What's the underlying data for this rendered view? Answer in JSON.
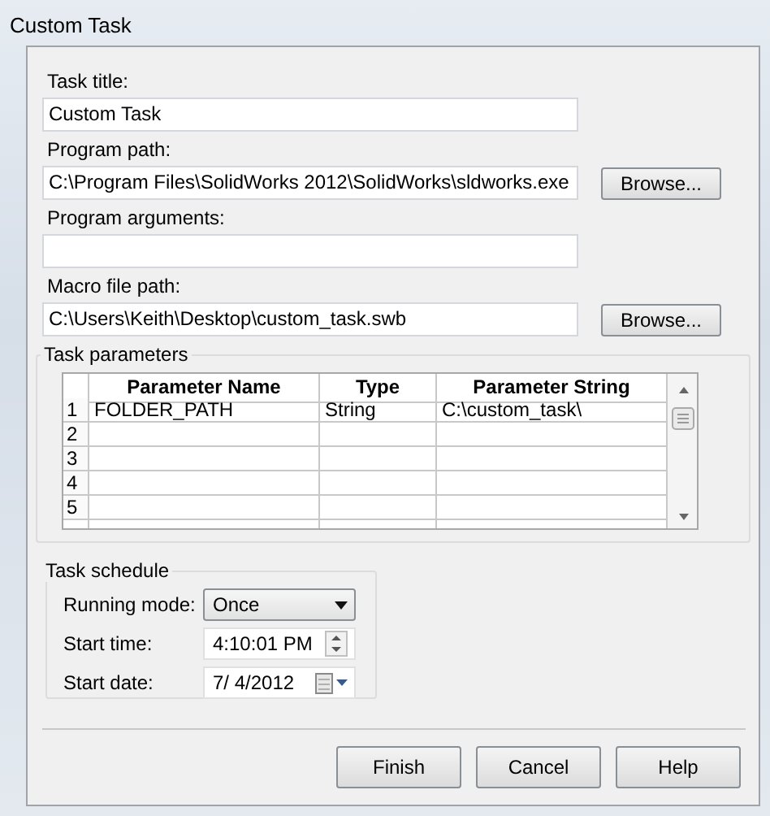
{
  "window": {
    "title": "Custom Task"
  },
  "fields": [
    {
      "label": "Task title:",
      "value": "Custom Task"
    },
    {
      "label": "Program path:",
      "value": "C:\\Program Files\\SolidWorks 2012\\SolidWorks\\sldworks.exe",
      "button": "Browse..."
    },
    {
      "label": "Program arguments:"
    },
    {
      "label": "Macro file path:",
      "value": "C:\\Users\\Keith\\Desktop\\custom_task.swb",
      "button": "Browse..."
    }
  ],
  "task_parameters": {
    "title": "Task parameters",
    "columns": [
      "Parameter Name",
      "Type",
      "Parameter String"
    ],
    "rows": [
      {
        "number": "1",
        "cells": [
          "FOLDER_PATH",
          "String",
          "C:\\custom_task\\"
        ]
      },
      {
        "number": "2"
      },
      {
        "number": "3"
      },
      {
        "number": "4"
      },
      {
        "number": "5"
      }
    ]
  },
  "task_schedule": {
    "title": "Task schedule",
    "items": [
      {
        "kind": "select",
        "label": "Running mode:",
        "value": "Once"
      },
      {
        "kind": "time",
        "label": "Start time:",
        "value": "4:10:01 PM"
      },
      {
        "kind": "date",
        "label": "Start date:",
        "value": "7/  4/2012"
      }
    ]
  },
  "buttons": [
    "Finish",
    "Cancel",
    "Help"
  ]
}
